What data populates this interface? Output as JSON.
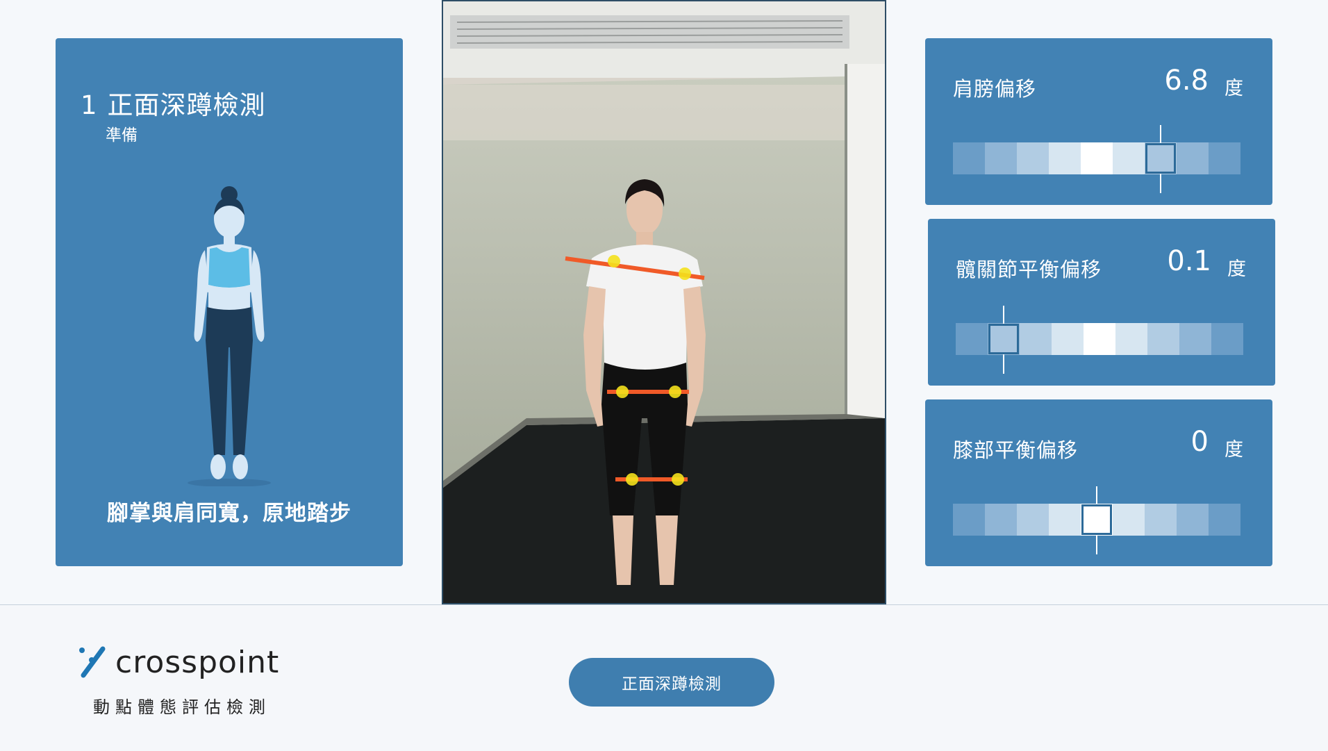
{
  "step": {
    "number": "1",
    "title": "正面深蹲檢測",
    "status": "準備",
    "instruction": "腳掌與肩同寬，原地踏步"
  },
  "metrics": [
    {
      "label": "肩膀偏移",
      "value": "6.8",
      "unit": "度",
      "segments": 9,
      "marker_index": 6
    },
    {
      "label": "髖關節平衡偏移",
      "value": "0.1",
      "unit": "度",
      "segments": 9,
      "marker_index": 1
    },
    {
      "label": "膝部平衡偏移",
      "value": "0",
      "unit": "度",
      "segments": 9,
      "marker_index": 4
    }
  ],
  "gauge_colors": [
    "#6b9dc7",
    "#8fb5d6",
    "#b1cce3",
    "#d7e6f1",
    "#ffffff",
    "#d7e6f1",
    "#b1cce3",
    "#8fb5d6",
    "#6b9dc7"
  ],
  "brand": {
    "name": "crosspoint",
    "subtitle": "動點體態評估檢測",
    "accent": "#1f77b4"
  },
  "action_button": {
    "label": "正面深蹲檢測"
  },
  "colors": {
    "panel": "#4282b4",
    "overlay_line": "#f05a28",
    "joint_dot": "#f4e11c"
  }
}
